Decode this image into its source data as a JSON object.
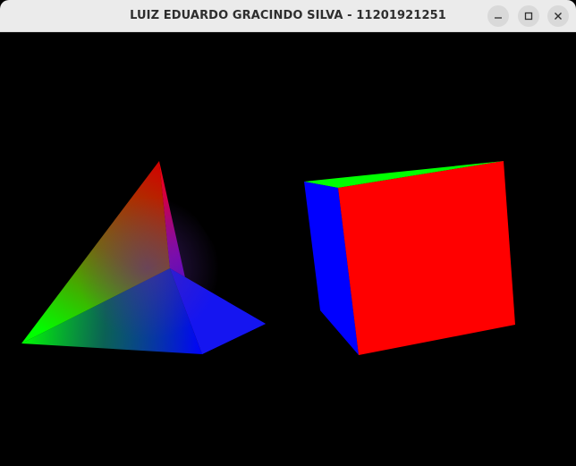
{
  "window": {
    "title": "LUIZ EDUARDO GRACINDO SILVA - 11201921251",
    "controls": {
      "minimize_icon": "minimize-icon",
      "maximize_icon": "maximize-icon",
      "close_icon": "close-icon"
    }
  },
  "scene": {
    "background": "#000000",
    "objects": [
      {
        "name": "pyramid",
        "vertex_colors": [
          "#ff0000",
          "#00ff00",
          "#0000ff"
        ]
      },
      {
        "name": "cube",
        "face_colors": {
          "front": "#ff0000",
          "left": "#0000ff",
          "top": "#00ff00"
        }
      }
    ]
  }
}
